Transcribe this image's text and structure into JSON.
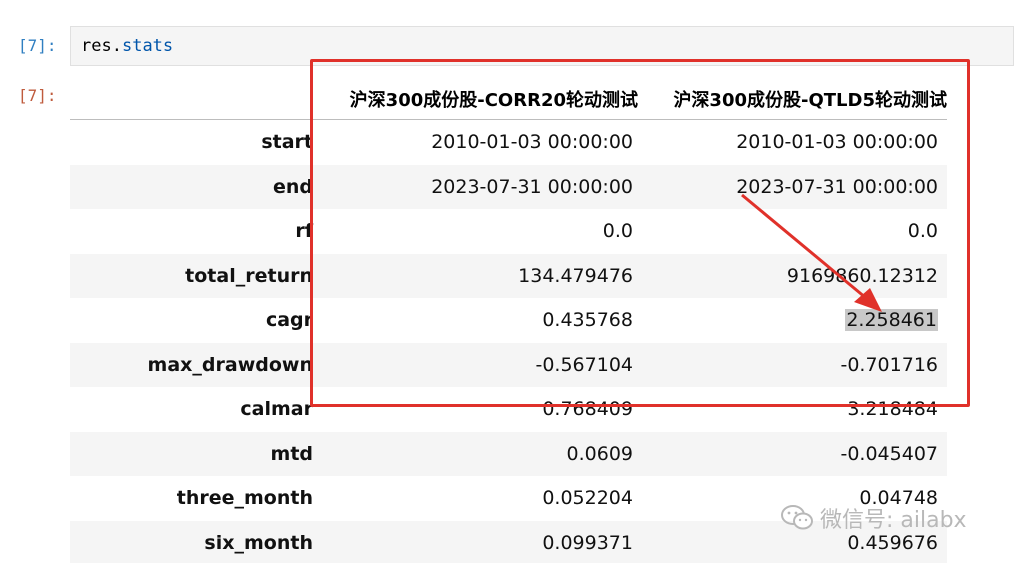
{
  "cells": {
    "input_prompt": "[7]:",
    "output_prompt": "[7]:",
    "code_object": "res",
    "code_dot": ".",
    "code_attr": "stats"
  },
  "table": {
    "columns": [
      "沪深300成份股-CORR20轮动测试",
      "沪深300成份股-QTLD5轮动测试"
    ],
    "rows": [
      {
        "label": "start",
        "values": [
          "2010-01-03 00:00:00",
          "2010-01-03 00:00:00"
        ]
      },
      {
        "label": "end",
        "values": [
          "2023-07-31 00:00:00",
          "2023-07-31 00:00:00"
        ]
      },
      {
        "label": "rf",
        "values": [
          "0.0",
          "0.0"
        ]
      },
      {
        "label": "total_return",
        "values": [
          "134.479476",
          "9169860.12312"
        ]
      },
      {
        "label": "cagr",
        "values": [
          "0.435768",
          "2.258461"
        ]
      },
      {
        "label": "max_drawdown",
        "values": [
          "-0.567104",
          "-0.701716"
        ]
      },
      {
        "label": "calmar",
        "values": [
          "0.768409",
          "3.218484"
        ]
      },
      {
        "label": "mtd",
        "values": [
          "0.0609",
          "-0.045407"
        ]
      },
      {
        "label": "three_month",
        "values": [
          "0.052204",
          "0.04748"
        ]
      },
      {
        "label": "six_month",
        "values": [
          "0.099371",
          "0.459676"
        ]
      }
    ]
  },
  "annotation": {
    "box_color": "#e0312a",
    "arrow_color": "#e0312a",
    "highlighted_value": "2.258461"
  },
  "watermark": {
    "icon": "wechat-icon",
    "text": "微信号: ailabx"
  }
}
